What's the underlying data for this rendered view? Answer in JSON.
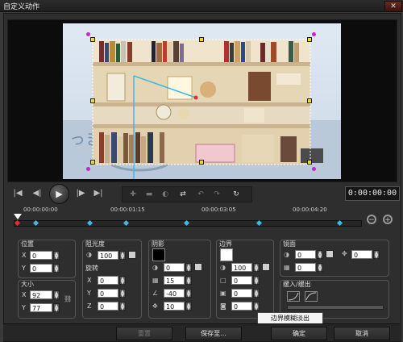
{
  "window": {
    "title": "自定义动作",
    "close": "✕"
  },
  "transport": {
    "timecode": "0:00:00:00",
    "buttons": [
      "|◀",
      "◀|",
      "▶",
      "|▶",
      "▶|"
    ]
  },
  "timeline": {
    "ticks": [
      "00:00:00:00",
      "00:00:01:15",
      "00:00:03:05",
      "00:00:04:20"
    ]
  },
  "position": {
    "label": "位置",
    "x_label": "X",
    "x": "0",
    "y_label": "Y",
    "y": "0"
  },
  "size": {
    "label": "大小",
    "x_label": "X",
    "x": "92",
    "y_label": "Y",
    "y": "77"
  },
  "opacity": {
    "label": "阻光度",
    "value": "100"
  },
  "rotation": {
    "label": "旋转",
    "x_label": "X",
    "x": "0",
    "y_label": "Y",
    "y": "0",
    "z_label": "Z",
    "z": "0"
  },
  "shadow": {
    "label": "阴影",
    "color": "#000000",
    "opacity": "0",
    "blur": "15",
    "angle": "-40",
    "distance": "10"
  },
  "border": {
    "label": "边界",
    "color": "#ffffff",
    "opacity": "100",
    "width": "0",
    "v2": "0",
    "v3": "0",
    "v4": "0"
  },
  "mirror": {
    "label": "镜面",
    "v1": "0",
    "v2": "0",
    "v3": "0"
  },
  "fade": {
    "label": "缓入/缓出"
  },
  "tooltip": "边界模糊淡出",
  "buttons": {
    "reset": "重置",
    "save": "保存至...",
    "ok": "确定",
    "cancel": "取消"
  },
  "colors": {
    "accent": "#3fb8e6",
    "handle": "#f0e000",
    "marker": "#d020d0"
  }
}
